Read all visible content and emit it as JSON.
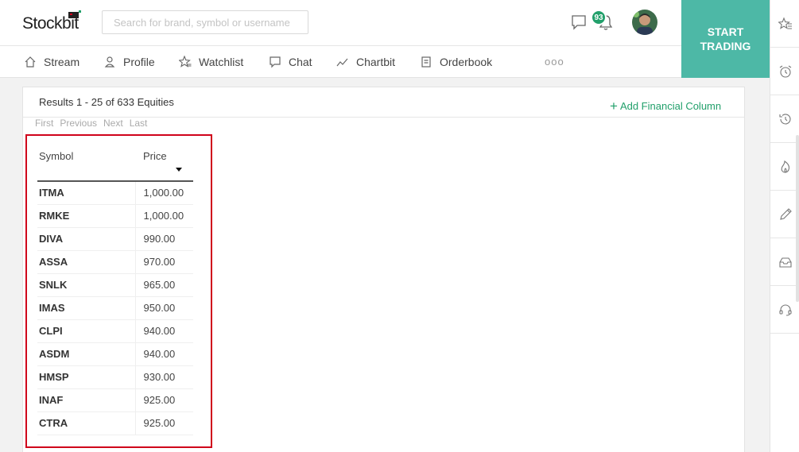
{
  "app": {
    "logo": "Stockbit"
  },
  "search": {
    "placeholder": "Search for brand, symbol or username"
  },
  "notifications": {
    "count": "93"
  },
  "cta": {
    "line1": "START",
    "line2": "TRADING"
  },
  "nav": {
    "items": [
      {
        "label": "Stream",
        "icon": "home-icon"
      },
      {
        "label": "Profile",
        "icon": "user-icon"
      },
      {
        "label": "Watchlist",
        "icon": "watchlist-star-icon"
      },
      {
        "label": "Chat",
        "icon": "chat-icon"
      },
      {
        "label": "Chartbit",
        "icon": "chart-icon"
      },
      {
        "label": "Orderbook",
        "icon": "orderbook-icon"
      }
    ],
    "more": "ooo"
  },
  "sidebar_right": {
    "icons": [
      "watchlist-star-icon",
      "alarm-icon",
      "history-icon",
      "fire-icon",
      "pencil-icon",
      "inbox-icon",
      "headset-icon"
    ]
  },
  "screener": {
    "results_text": "Results 1 - 25 of 633 Equities",
    "add_column": "Add Financial Column",
    "pager": {
      "first": "First",
      "previous": "Previous",
      "next": "Next",
      "last": "Last"
    },
    "columns": {
      "symbol": "Symbol",
      "price": "Price"
    },
    "rows": [
      {
        "symbol": "ITMA",
        "price": "1,000.00"
      },
      {
        "symbol": "RMKE",
        "price": "1,000.00"
      },
      {
        "symbol": "DIVA",
        "price": "990.00"
      },
      {
        "symbol": "ASSA",
        "price": "970.00"
      },
      {
        "symbol": "SNLK",
        "price": "965.00"
      },
      {
        "symbol": "IMAS",
        "price": "950.00"
      },
      {
        "symbol": "CLPI",
        "price": "940.00"
      },
      {
        "symbol": "ASDM",
        "price": "940.00"
      },
      {
        "symbol": "HMSP",
        "price": "930.00"
      },
      {
        "symbol": "INAF",
        "price": "925.00"
      },
      {
        "symbol": "CTRA",
        "price": "925.00"
      }
    ]
  },
  "colors": {
    "accent": "#22a06b",
    "cta": "#4db8a6",
    "highlight": "#d0021b"
  }
}
